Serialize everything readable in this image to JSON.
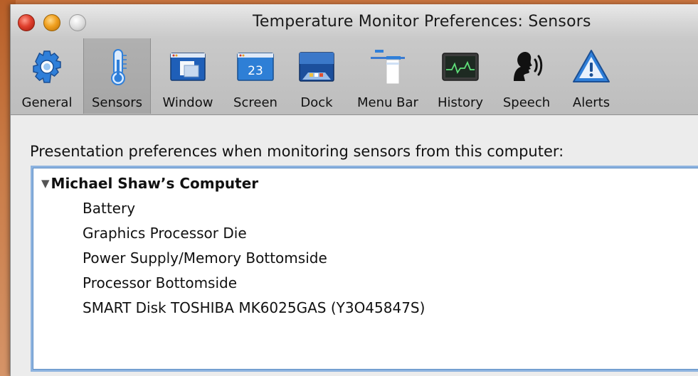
{
  "window": {
    "title": "Temperature Monitor Preferences: Sensors"
  },
  "toolbar": {
    "items": [
      {
        "label": "General",
        "icon": "gear-icon",
        "selected": false
      },
      {
        "label": "Sensors",
        "icon": "thermometer-icon",
        "selected": true
      },
      {
        "label": "Window",
        "icon": "window-icon",
        "selected": false
      },
      {
        "label": "Screen",
        "icon": "screen-icon",
        "selected": false
      },
      {
        "label": "Dock",
        "icon": "dock-icon",
        "selected": false
      },
      {
        "label": "Menu Bar",
        "icon": "menu-bar-icon",
        "selected": false
      },
      {
        "label": "History",
        "icon": "history-icon",
        "selected": false
      },
      {
        "label": "Speech",
        "icon": "speech-icon",
        "selected": false
      },
      {
        "label": "Alerts",
        "icon": "alert-icon",
        "selected": false
      }
    ],
    "screen_icon_number": "23"
  },
  "sensors": {
    "prompt": "Presentation preferences when monitoring sensors from this computer:",
    "disclosure_symbol": "▼",
    "computer_name": "Michael Shaw’s Computer",
    "items": [
      "Battery",
      "Graphics Processor Die",
      "Power Supply/Memory Bottomside",
      "Processor Bottomside",
      "SMART Disk TOSHIBA MK6025GAS (Y3O45847S)"
    ]
  },
  "colors": {
    "accent": "#3b7bd0",
    "selection_border": "#8db3df"
  }
}
